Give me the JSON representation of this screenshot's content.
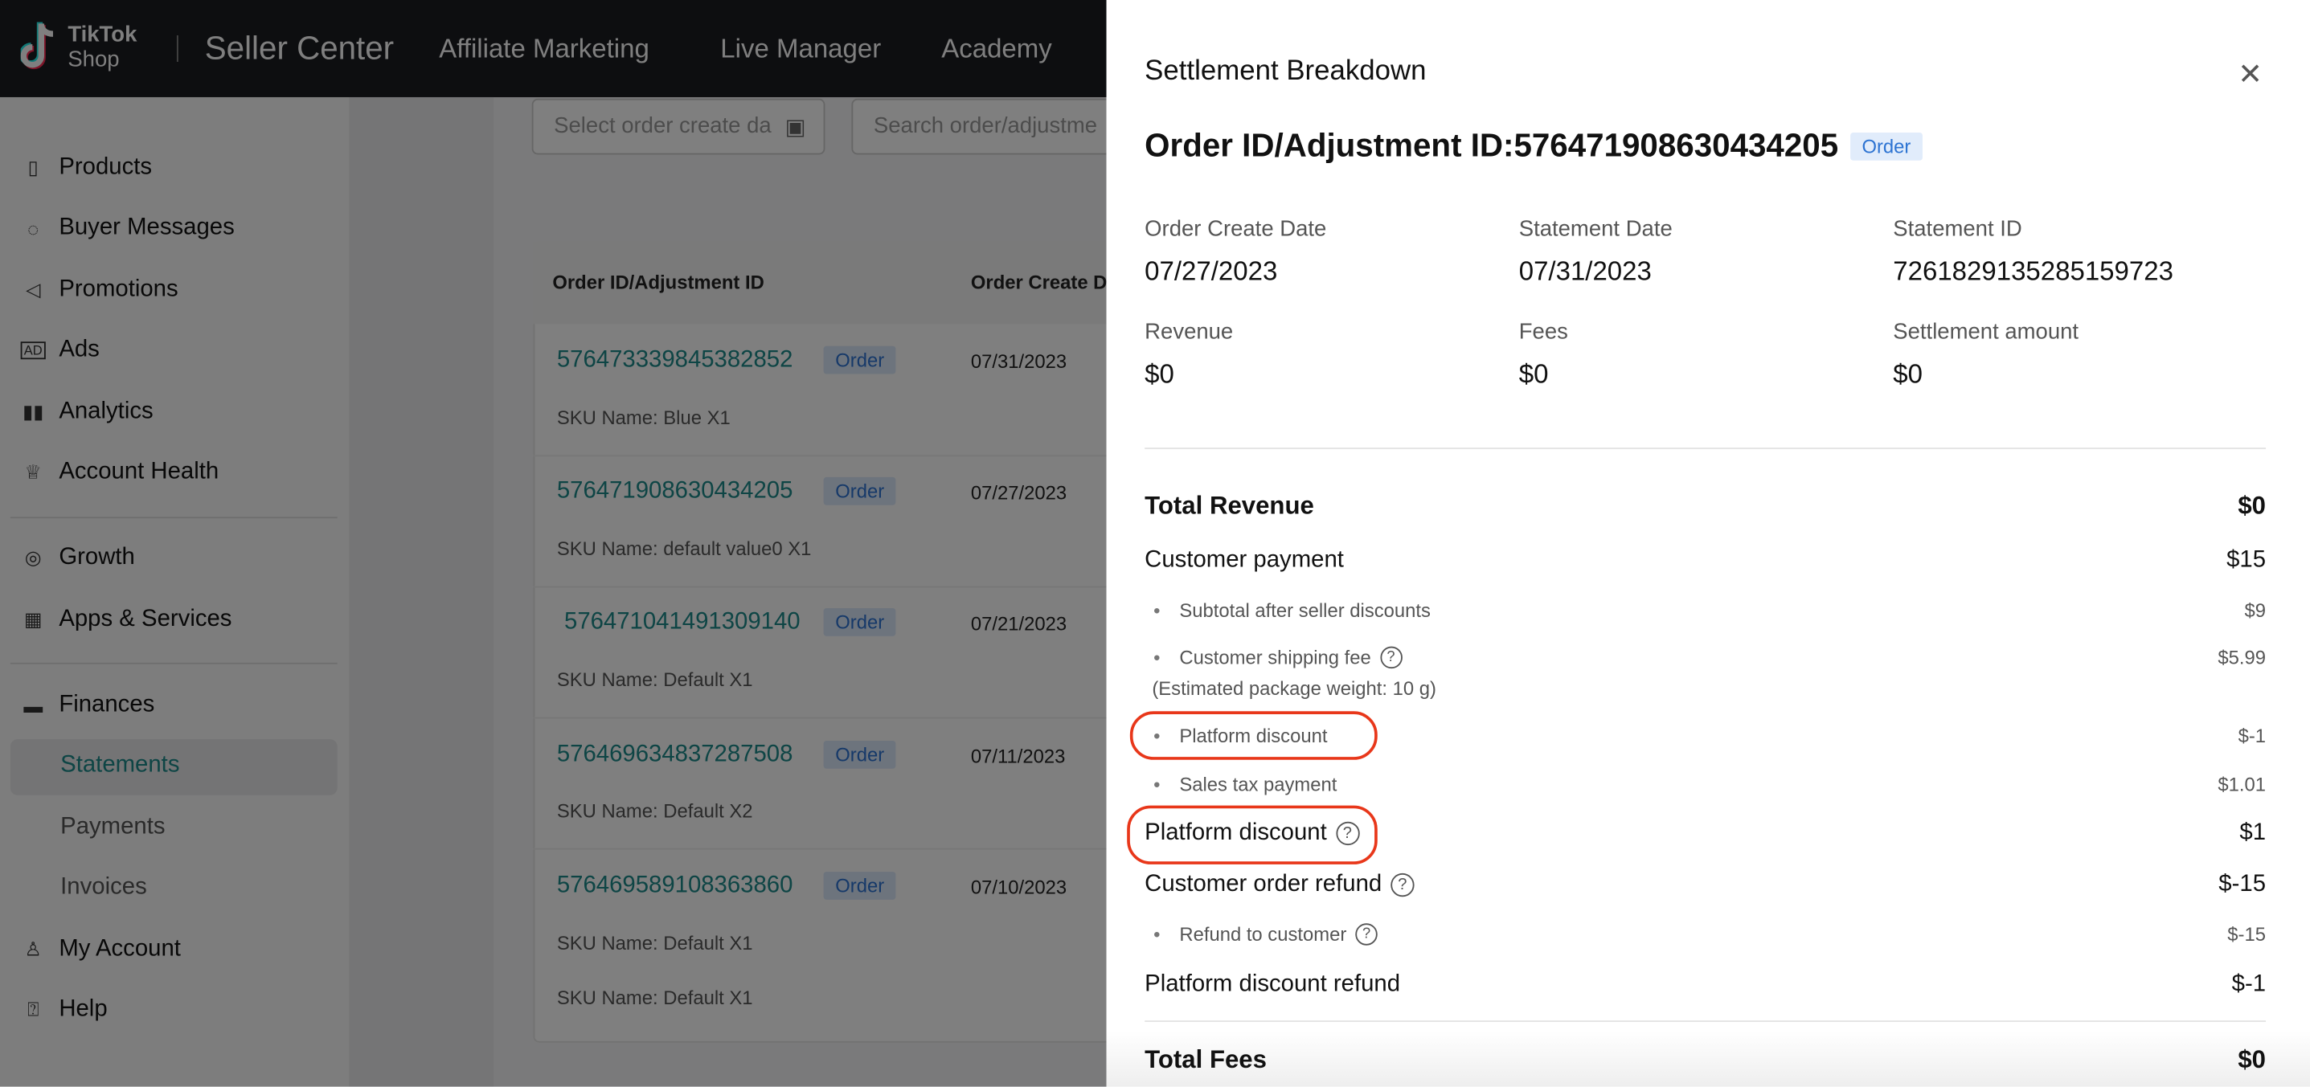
{
  "header": {
    "logo_line1": "TikTok",
    "logo_line2": "Shop",
    "brand": "Seller Center",
    "nav": [
      "Affiliate Marketing",
      "Live Manager",
      "Academy"
    ]
  },
  "sidebar": {
    "items": [
      {
        "label": "Products",
        "icon": "product-icon"
      },
      {
        "label": "Buyer Messages",
        "icon": "chat-icon"
      },
      {
        "label": "Promotions",
        "icon": "megaphone-icon"
      },
      {
        "label": "Ads",
        "icon": "ad-icon"
      },
      {
        "label": "Analytics",
        "icon": "bar-chart-icon"
      },
      {
        "label": "Account Health",
        "icon": "trophy-icon"
      },
      {
        "label": "Growth",
        "icon": "medal-icon"
      },
      {
        "label": "Apps & Services",
        "icon": "apps-icon"
      },
      {
        "label": "Finances",
        "icon": "wallet-icon"
      },
      {
        "label": "Statements",
        "selected": true
      },
      {
        "label": "Payments"
      },
      {
        "label": "Invoices"
      },
      {
        "label": "My Account",
        "icon": "user-icon"
      },
      {
        "label": "Help",
        "icon": "help-icon"
      }
    ]
  },
  "filters": {
    "date_placeholder": "Select order create da",
    "search_placeholder": "Search order/adjustme"
  },
  "table": {
    "headers": [
      "Order ID/Adjustment ID",
      "Order Create D"
    ],
    "rows": [
      {
        "id": "576473339845382852",
        "type": "Order",
        "date": "07/31/2023",
        "skus": [
          "SKU Name: Blue X1"
        ]
      },
      {
        "id": "576471908630434205",
        "type": "Order",
        "date": "07/27/2023",
        "skus": [
          "SKU Name: default value0 X1"
        ]
      },
      {
        "id": "576471041491309140",
        "type": "Order",
        "date": "07/21/2023",
        "skus": [
          "SKU Name: Default X1"
        ]
      },
      {
        "id": "576469634837287508",
        "type": "Order",
        "date": "07/11/2023",
        "skus": [
          "SKU Name: Default X2"
        ]
      },
      {
        "id": "576469589108363860",
        "type": "Order",
        "date": "07/10/2023",
        "skus": [
          "SKU Name: Default X1",
          "SKU Name: Default X1"
        ]
      }
    ]
  },
  "panel": {
    "title": "Settlement Breakdown",
    "order_heading": "Order ID/Adjustment ID:576471908630434205",
    "order_badge": "Order",
    "summary": [
      {
        "label": "Order Create Date",
        "value": "07/27/2023"
      },
      {
        "label": "Statement Date",
        "value": "07/31/2023"
      },
      {
        "label": "Statement ID",
        "value": "7261829135285159723"
      },
      {
        "label": "Revenue",
        "value": "$0"
      },
      {
        "label": "Fees",
        "value": "$0"
      },
      {
        "label": "Settlement amount",
        "value": "$0"
      }
    ],
    "total_revenue": {
      "label": "Total Revenue",
      "value": "$0"
    },
    "customer_payment": {
      "label": "Customer payment",
      "value": "$15"
    },
    "subtotal": {
      "label": "Subtotal after seller discounts",
      "value": "$9"
    },
    "shipping": {
      "label": "Customer shipping fee",
      "note": "(Estimated package weight: 10 g)",
      "value": "$5.99"
    },
    "platform_discount_sub": {
      "label": "Platform discount",
      "value": "$-1"
    },
    "sales_tax": {
      "label": "Sales tax payment",
      "value": "$1.01"
    },
    "platform_discount": {
      "label": "Platform discount",
      "value": "$1"
    },
    "customer_refund": {
      "label": "Customer order refund",
      "value": "$-15"
    },
    "refund_to_customer": {
      "label": "Refund to customer",
      "value": "$-15"
    },
    "platform_discount_refund": {
      "label": "Platform discount refund",
      "value": "$-1"
    },
    "total_fees": {
      "label": "Total Fees",
      "value": "$0"
    }
  },
  "colors": {
    "highlight": "#e8371a",
    "link": "#1d8a8a",
    "badge": "#2c73d2"
  }
}
